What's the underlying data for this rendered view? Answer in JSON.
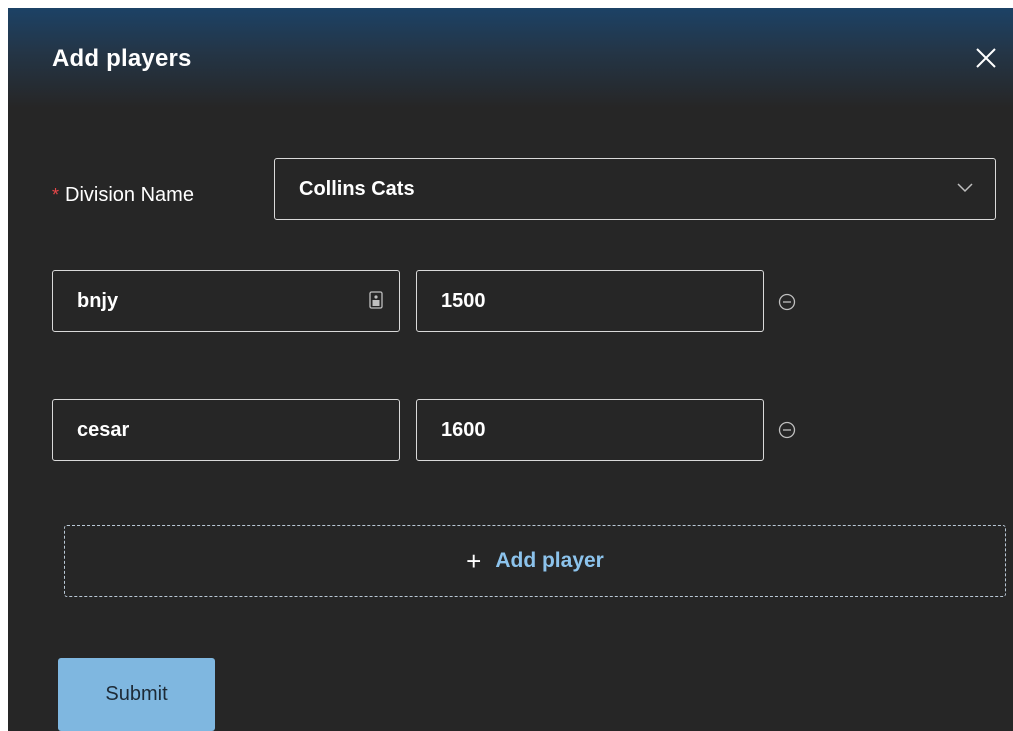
{
  "modal": {
    "title": "Add players",
    "close_icon": "close-icon"
  },
  "division": {
    "required_marker": "*",
    "label": "Division Name",
    "value": "Collins Cats",
    "icon": "chevron-down-icon"
  },
  "players": [
    {
      "name": "bnjy",
      "score": "1500",
      "name_icon": "autofill-icon",
      "remove_icon": "minus-circle-icon"
    },
    {
      "name": "cesar",
      "score": "1600",
      "remove_icon": "minus-circle-icon"
    }
  ],
  "add_player": {
    "icon": "+",
    "label": "Add player"
  },
  "submit": {
    "label": "Submit"
  },
  "colors": {
    "background": "#262626",
    "header_gradient_top": "#1c4266",
    "accent": "#7fb7e0",
    "link": "#8cc3ec",
    "required": "#e84749",
    "border": "#d9d9d9"
  }
}
